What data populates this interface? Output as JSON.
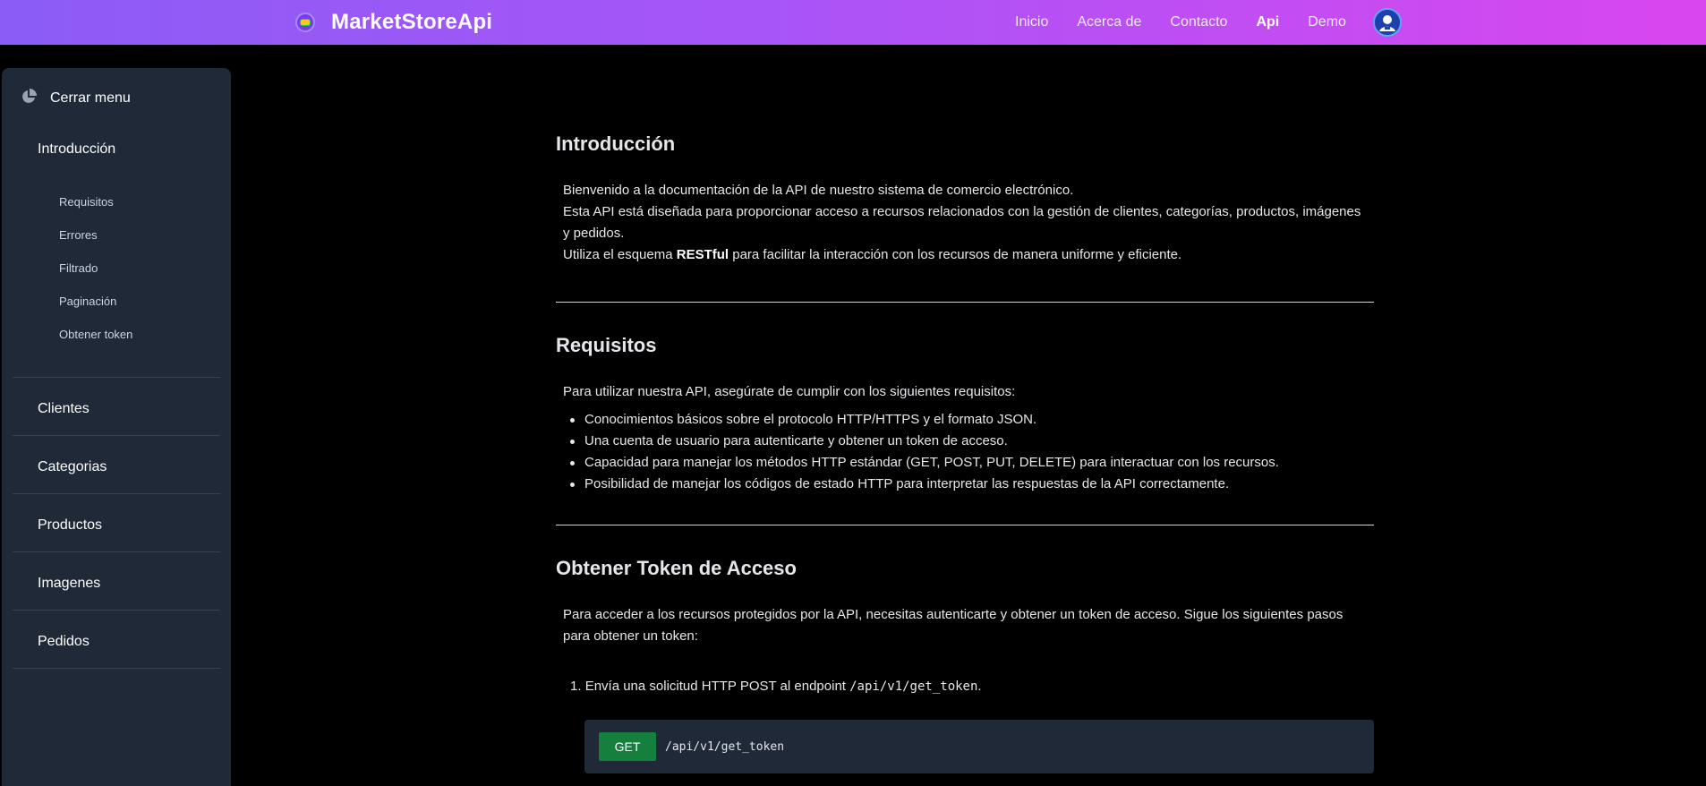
{
  "navbar": {
    "brand": "MarketStoreApi",
    "links": [
      "Inicio",
      "Acerca de",
      "Contacto",
      "Api",
      "Demo"
    ],
    "active_link": "Api",
    "avatar_icon": "user-avatar-icon",
    "gradient_start": "#8b5cf6",
    "gradient_end": "#d946ef"
  },
  "sidebar": {
    "close_label": "Cerrar menu",
    "sections": [
      {
        "label": "Introducción",
        "subitems": [
          "Requisitos",
          "Errores",
          "Filtrado",
          "Paginación",
          "Obtener token"
        ]
      },
      {
        "label": "Clientes"
      },
      {
        "label": "Categorias"
      },
      {
        "label": "Productos"
      },
      {
        "label": "Imagenes"
      },
      {
        "label": "Pedidos"
      }
    ]
  },
  "main": {
    "intro": {
      "title": "Introducción",
      "line1": "Bienvenido a la documentación de la API de nuestro sistema de comercio electrónico.",
      "line2": "Esta API está diseñada para proporcionar acceso a recursos relacionados con la gestión de clientes, categorías, productos, imágenes y pedidos.",
      "line3_prefix": "Utiliza el esquema ",
      "line3_bold": "RESTful",
      "line3_suffix": " para facilitar la interacción con los recursos de manera uniforme y eficiente."
    },
    "requirements": {
      "title": "Requisitos",
      "lead": "Para utilizar nuestra API, asegúrate de cumplir con los siguientes requisitos:",
      "items": [
        "Conocimientos básicos sobre el protocolo HTTP/HTTPS y el formato JSON.",
        "Una cuenta de usuario para autenticarte y obtener un token de acceso.",
        "Capacidad para manejar los métodos HTTP estándar (GET, POST, PUT, DELETE) para interactuar con los recursos.",
        "Posibilidad de manejar los códigos de estado HTTP para interpretar las respuestas de la API correctamente."
      ]
    },
    "token": {
      "title": "Obtener Token de Acceso",
      "lead": "Para acceder a los recursos protegidos por la API, necesitas autenticarte y obtener un token de acceso. Sigue los siguientes pasos para obtener un token:",
      "step1_number": "1.",
      "step1_text": "Envía una solicitud HTTP POST al endpoint ",
      "step1_code": "/api/v1/get_token",
      "step1_end": ".",
      "endpoint_method": "GET",
      "endpoint_path": "/api/v1/get_token",
      "method_color": "#15803d"
    }
  }
}
